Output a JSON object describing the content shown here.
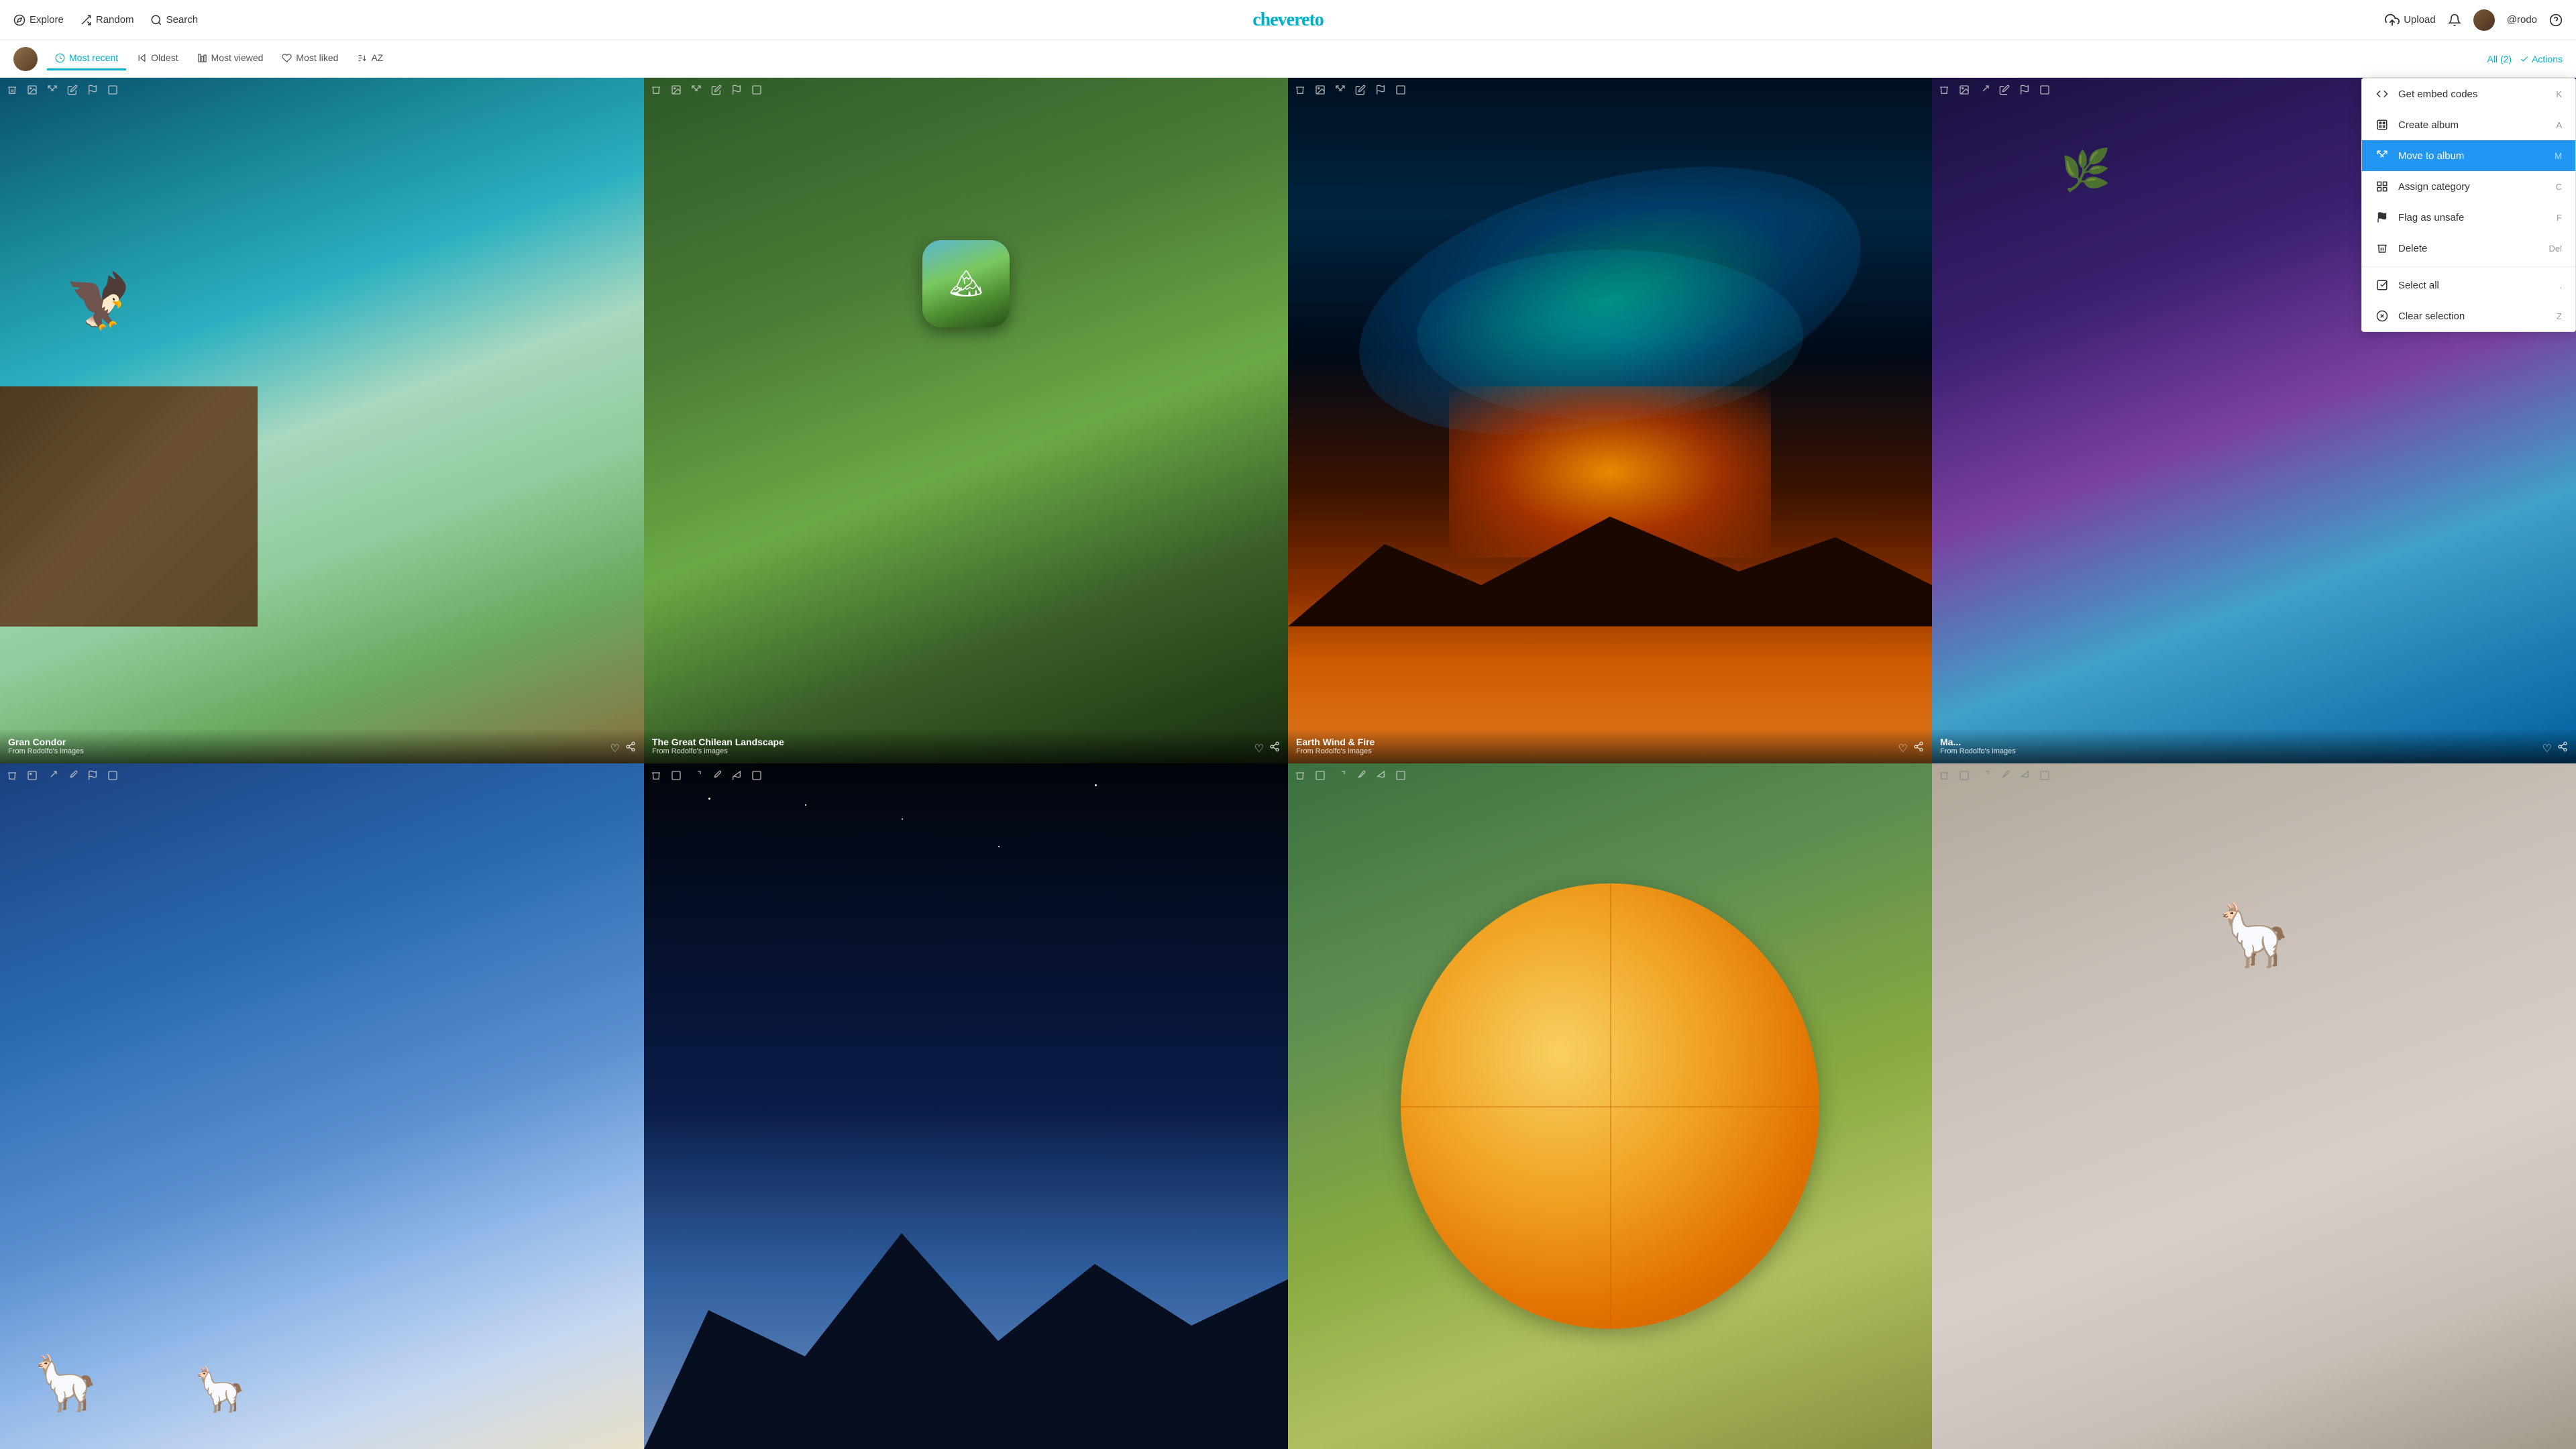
{
  "navbar": {
    "explore_label": "Explore",
    "random_label": "Random",
    "search_label": "Search",
    "logo": "chevereto",
    "upload_label": "Upload",
    "notifications_label": "",
    "user_label": "@rodo",
    "help_label": ""
  },
  "sortbar": {
    "most_recent_label": "Most recent",
    "oldest_label": "Oldest",
    "most_viewed_label": "Most viewed",
    "most_liked_label": "Most liked",
    "az_label": "AZ",
    "all_count_label": "All (2)",
    "actions_label": "Actions"
  },
  "images": [
    {
      "id": 1,
      "title": "Gran Condor",
      "subtitle": "From Rodolfo's images",
      "bg_class": "cell-1"
    },
    {
      "id": 2,
      "title": "The Great Chilean Landscape",
      "subtitle": "From Rodolfo's images",
      "bg_class": "cell-2"
    },
    {
      "id": 3,
      "title": "Earth Wind & Fire",
      "subtitle": "From Rodolfo's images",
      "bg_class": "cell-3"
    },
    {
      "id": 4,
      "title": "Ma...",
      "subtitle": "From Rodolfo's images",
      "bg_class": "cell-4"
    },
    {
      "id": 5,
      "title": "",
      "subtitle": "",
      "bg_class": "cell-5"
    },
    {
      "id": 6,
      "title": "",
      "subtitle": "",
      "bg_class": "cell-6"
    },
    {
      "id": 7,
      "title": "",
      "subtitle": "",
      "bg_class": "cell-7"
    },
    {
      "id": 8,
      "title": "",
      "subtitle": "",
      "bg_class": "cell-8"
    }
  ],
  "dropdown": {
    "items": [
      {
        "id": "embed",
        "label": "Get embed codes",
        "shortcut": "K",
        "icon": "code",
        "highlighted": false
      },
      {
        "id": "album",
        "label": "Create album",
        "shortcut": "A",
        "icon": "album",
        "highlighted": false
      },
      {
        "id": "move",
        "label": "Move to album",
        "shortcut": "M",
        "icon": "move",
        "highlighted": true
      },
      {
        "id": "category",
        "label": "Assign category",
        "shortcut": "C",
        "icon": "category",
        "highlighted": false
      },
      {
        "id": "flag",
        "label": "Flag as unsafe",
        "shortcut": "F",
        "icon": "flag",
        "highlighted": false
      },
      {
        "id": "delete",
        "label": "Delete",
        "shortcut": "Del",
        "icon": "trash",
        "highlighted": false
      },
      {
        "id": "selectall",
        "label": "Select all",
        "shortcut": ".",
        "icon": "check",
        "highlighted": false
      },
      {
        "id": "clearsel",
        "label": "Clear selection",
        "shortcut": "Z",
        "icon": "x",
        "highlighted": false
      }
    ]
  }
}
